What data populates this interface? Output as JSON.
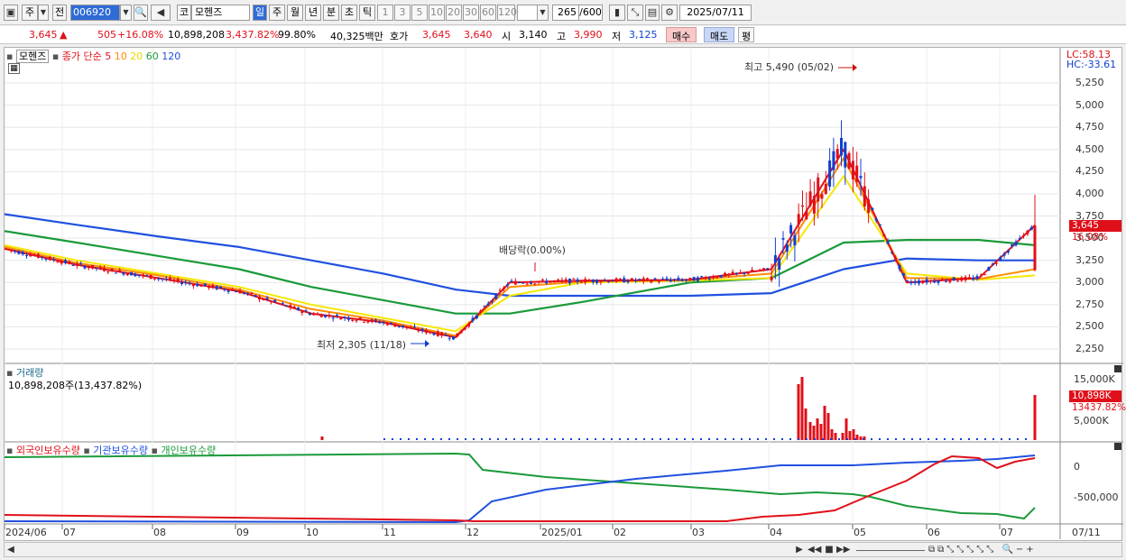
{
  "toolbar": {
    "period_label": "주",
    "prev_label": "전",
    "stock_code": "006920",
    "market_label": "코",
    "stock_name": "모헨즈",
    "tabs": [
      "일",
      "주",
      "월",
      "년",
      "분",
      "초",
      "틱"
    ],
    "active_tab": "일",
    "minute_options": [
      "1",
      "3",
      "5",
      "10",
      "20",
      "30",
      "60",
      "120"
    ],
    "count_value": "265",
    "count_total": "/600",
    "date_value": "2025/07/11"
  },
  "quote": {
    "price": "3,645",
    "change_arrow": "▲",
    "change": "505",
    "change_pct": "+16.08%",
    "volume": "10,898,208",
    "volume_pct": "3,437.82%",
    "ratio": "99.80%",
    "amount": "40,325백만",
    "bid_label": "호가",
    "ask_price": "3,645",
    "bid_price": "3,640",
    "open_label": "시",
    "open": "3,140",
    "high_label": "고",
    "high": "3,990",
    "low_label": "저",
    "low": "3,125",
    "buy_label": "매수",
    "sell_label": "매도",
    "avg_label": "평"
  },
  "price_panel": {
    "stock_name": "모헨즈",
    "ma_label": "종가 단순",
    "ma_periods": [
      "5",
      "10",
      "20",
      "60",
      "120"
    ],
    "lc": "LC:58.13",
    "hc": "HC:-33.61",
    "max_label": "최고 5,490 (05/02)",
    "min_label": "최저 2,305 (11/18)",
    "dividend_label": "배당락(0.00%)",
    "y_ticks": [
      "5,250",
      "5,000",
      "4,750",
      "4,500",
      "4,250",
      "4,000",
      "3,750",
      "3,500",
      "3,250",
      "3,000",
      "2,750",
      "2,500",
      "2,250"
    ],
    "last_price_tag": "3,645",
    "last_pct_tag": "16.08%"
  },
  "volume_panel": {
    "title": "거래량",
    "info": "10,898,208주(13,437.82%)",
    "y_ticks": [
      "15,000K",
      "5,000K"
    ],
    "last_tag": "10,898K",
    "last_pct": "13437.82%"
  },
  "holdings_panel": {
    "labels": [
      "외국인보유수량",
      "기관보유수량",
      "개인보유수량"
    ],
    "y_ticks": [
      "0",
      "-500,000"
    ]
  },
  "x_axis": {
    "labels": [
      "2024/06",
      "07",
      "08",
      "09",
      "10",
      "11",
      "12",
      "2025/01",
      "02",
      "03",
      "04",
      "05",
      "06",
      "07"
    ],
    "right_label": "07/11"
  },
  "colors": {
    "up": "#e0101a",
    "down": "#1040d0",
    "ma5": "#e0101a",
    "ma10": "#ff8c00",
    "ma20": "#f5e800",
    "ma60": "#1a9a3a",
    "ma120": "#2050e0"
  },
  "chart_data": {
    "type": "line",
    "title": "",
    "ylim": [
      2250,
      5250
    ],
    "series": [
      {
        "name": "5",
        "values": [
          3380,
          3200,
          3050,
          2900,
          2650,
          2550,
          2380,
          3000,
          3020,
          3030,
          3150,
          4500,
          3000,
          3050,
          3645
        ]
      },
      {
        "name": "10",
        "values": [
          3400,
          3220,
          3080,
          2920,
          2700,
          2570,
          2400,
          2950,
          3010,
          3030,
          3100,
          4400,
          3050,
          3040,
          3150
        ]
      },
      {
        "name": "20",
        "values": [
          3420,
          3250,
          3100,
          2950,
          2750,
          2600,
          2450,
          2850,
          3000,
          3020,
          3050,
          4200,
          3100,
          3030,
          3080
        ]
      },
      {
        "name": "60",
        "values": [
          3580,
          3450,
          3300,
          3150,
          2950,
          2800,
          2650,
          2650,
          2780,
          3000,
          3050,
          3450,
          3480,
          3480,
          3420
        ]
      },
      {
        "name": "120",
        "values": [
          3770,
          3650,
          3520,
          3400,
          3250,
          3100,
          2920,
          2850,
          2850,
          2850,
          2880,
          3150,
          3270,
          3250,
          3250
        ]
      }
    ]
  }
}
